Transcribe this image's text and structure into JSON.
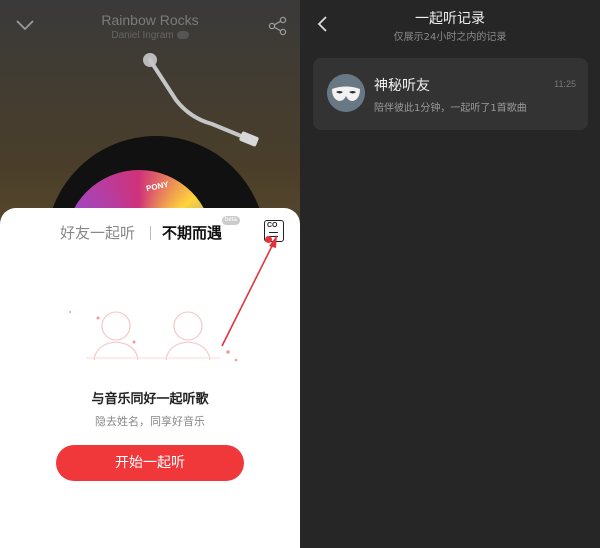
{
  "player": {
    "song_title": "Rainbow Rocks",
    "artist": "Daniel Ingram",
    "disc_logo": "PONY"
  },
  "listen_sheet": {
    "tab_friend": "好友一起听",
    "tab_random": "不期而遇",
    "beta_badge": "beta",
    "record_button_text": "CO",
    "title": "与音乐同好一起听歌",
    "subtitle": "隐去姓名，同享好音乐",
    "start_button": "开始一起听"
  },
  "record_page": {
    "title": "一起听记录",
    "subtitle": "仅展示24小时之内的记录",
    "records": [
      {
        "name": "神秘听友",
        "description": "陪伴彼此1分钟，一起听了1首歌曲",
        "time": "11:25",
        "avatar_icon": "mask-icon"
      }
    ]
  },
  "colors": {
    "accent": "#f0383b",
    "annotation_arrow": "#e2333a",
    "record_bg": "#262626",
    "card_bg": "#333333"
  }
}
